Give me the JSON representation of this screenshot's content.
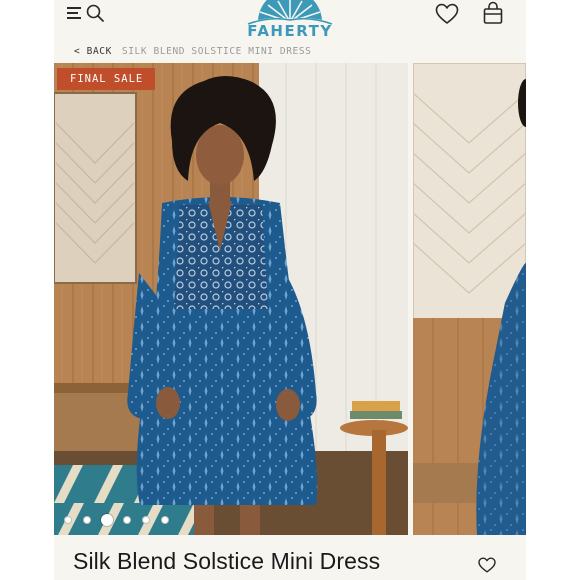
{
  "header": {
    "brand": "FAHERTY",
    "icons": [
      "menu-icon",
      "search-icon",
      "heart-icon",
      "shopping-bag-icon"
    ]
  },
  "breadcrumb": {
    "back_label": "< BACK",
    "current": "SILK BLEND SOLSTICE MINI DRESS"
  },
  "gallery": {
    "badge": "FINAL SALE",
    "slide_count": 6,
    "active_slide": 3
  },
  "product": {
    "title": "Silk Blend Solstice Mini Dress"
  },
  "colors": {
    "brand_blue": "#3c9ab8",
    "badge_rust": "#c14e2b",
    "dress_blue": "#1d5a8e",
    "page_bg": "#f7f5f0"
  }
}
